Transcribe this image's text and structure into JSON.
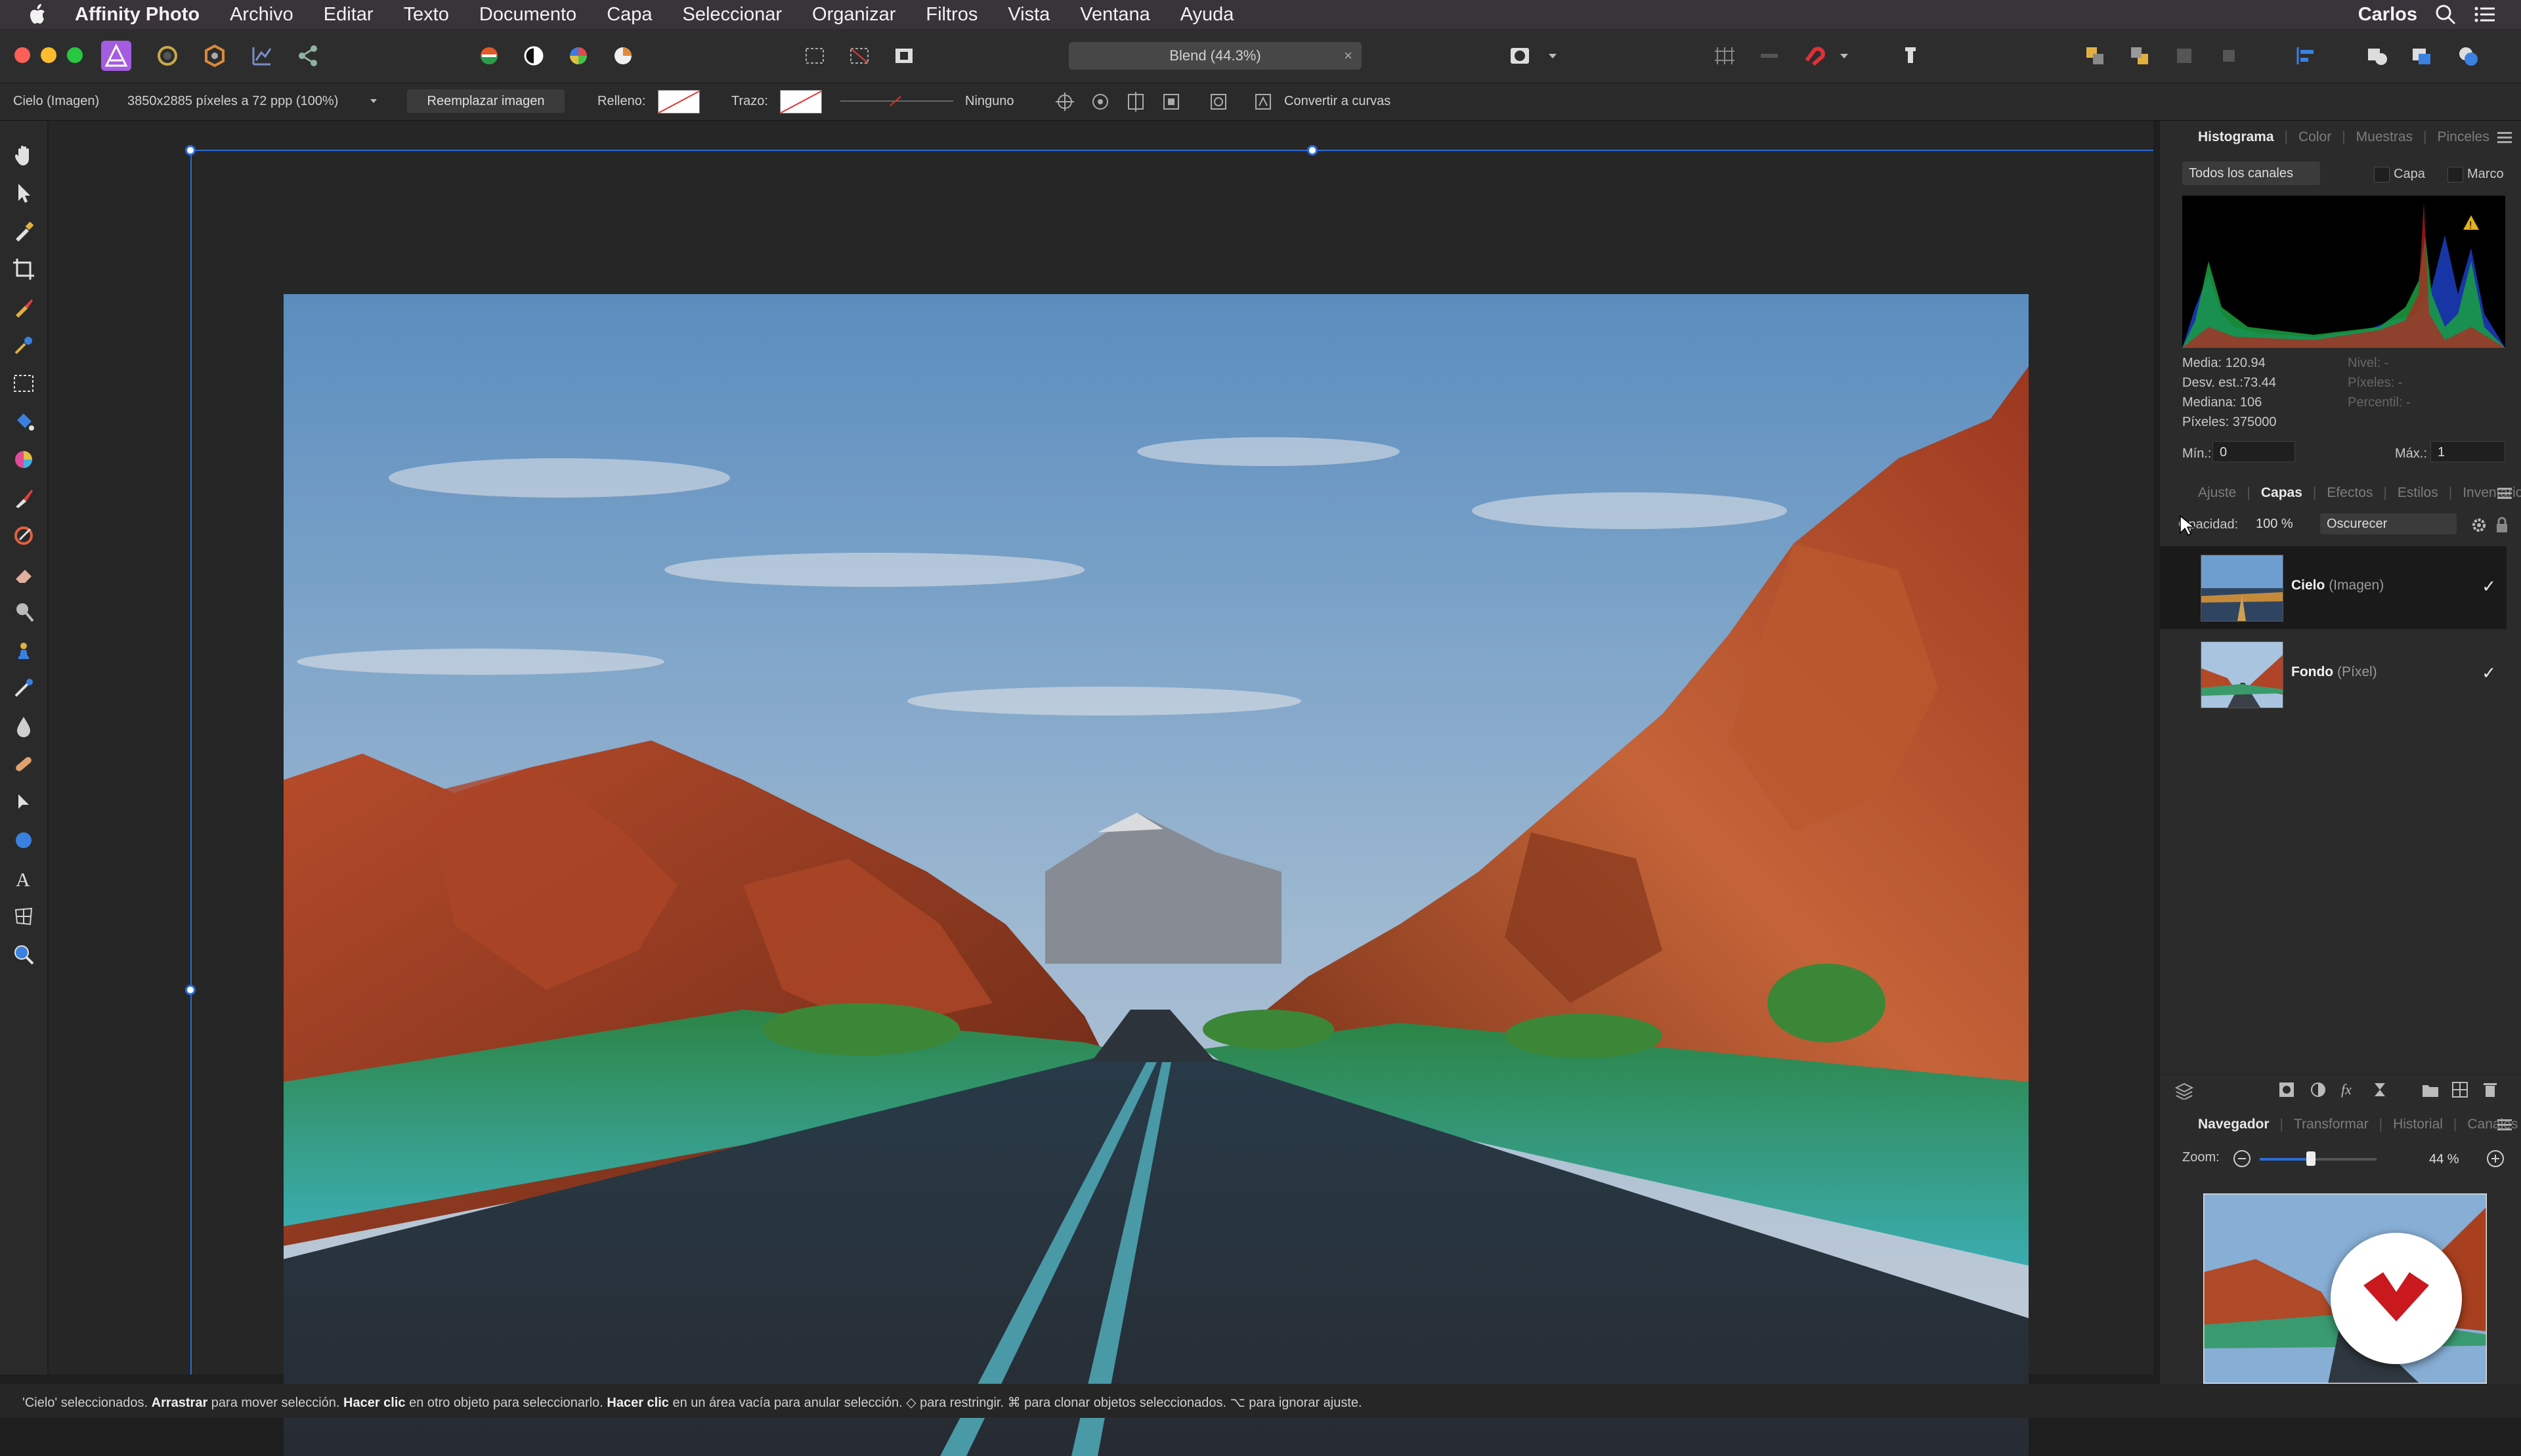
{
  "menubar": {
    "app_name": "Affinity Photo",
    "items": [
      "Archivo",
      "Editar",
      "Texto",
      "Documento",
      "Capa",
      "Seleccionar",
      "Organizar",
      "Filtros",
      "Vista",
      "Ventana",
      "Ayuda"
    ],
    "user": "Carlos"
  },
  "toolbar": {
    "document_title": "Blend (44.3%)",
    "close_glyph": "×"
  },
  "context": {
    "layer_label": "Cielo (Imagen)",
    "image_info": "3850x2885 píxeles a 72 ppp (100%)",
    "replace_image": "Reemplazar imagen",
    "fill_label": "Relleno:",
    "stroke_label": "Trazo:",
    "stroke_style": "Ninguno",
    "convert_curves": "Convertir a curvas"
  },
  "histogram_panel": {
    "tabs": [
      "Histograma",
      "Color",
      "Muestras",
      "Pinceles"
    ],
    "channel_select": "Todos los canales",
    "layer_check": "Capa",
    "frame_check": "Marco",
    "stats_left": [
      "Media: 120.94",
      "Desv. est.:73.44",
      "Mediana: 106",
      "Píxeles: 375000"
    ],
    "stats_right": [
      "Nivel: -",
      "Píxeles: -",
      "Percentil: -"
    ],
    "min_label": "Mín.:",
    "min_value": "0",
    "max_label": "Máx.:",
    "max_value": "1"
  },
  "layers_panel": {
    "tabs": [
      "Ajuste",
      "Capas",
      "Efectos",
      "Estilos",
      "Inventario"
    ],
    "opacity_label": "Opacidad:",
    "opacity_value": "100 %",
    "blend_mode": "Oscurecer",
    "layers": [
      {
        "name": "Cielo",
        "type": "(Imagen)",
        "visible_glyph": "✓"
      },
      {
        "name": "Fondo",
        "type": "(Píxel)",
        "visible_glyph": "✓"
      }
    ]
  },
  "navigator_panel": {
    "tabs": [
      "Navegador",
      "Transformar",
      "Historial",
      "Canales"
    ],
    "zoom_label": "Zoom:",
    "zoom_value": "44 %",
    "zoom_level": 0.44
  },
  "status": {
    "text_parts": [
      {
        "t": "'Cielo' seleccionados. ",
        "b": false
      },
      {
        "t": "Arrastrar",
        "b": true
      },
      {
        "t": " para mover selección. ",
        "b": false
      },
      {
        "t": "Hacer clic",
        "b": true
      },
      {
        "t": " en otro objeto para seleccionarlo. ",
        "b": false
      },
      {
        "t": "Hacer clic",
        "b": true
      },
      {
        "t": " en un área vacía para anular selección. ◇ para restringir. ⌘ para clonar objetos seleccionados. ⌥ para ignorar ajuste.",
        "b": false
      }
    ]
  },
  "colors": {
    "accent": "#2a6bd8",
    "logo_bg": "#c9191f",
    "affinity_icon": "#a45ce0"
  },
  "icons": {
    "apple": "apple-icon",
    "search": "search-icon",
    "list": "control-center-icon"
  }
}
